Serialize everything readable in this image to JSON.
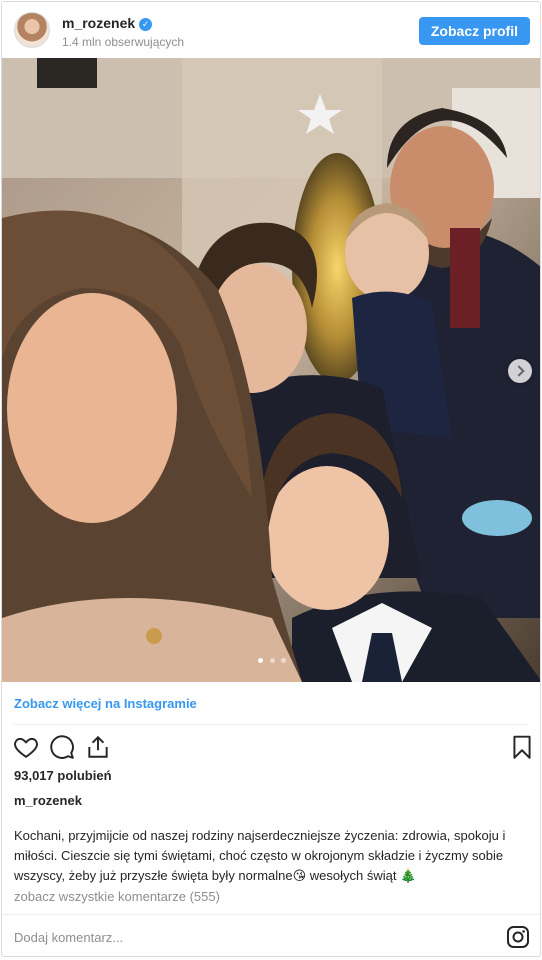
{
  "header": {
    "username": "m_rozenek",
    "verified_mark": "✓",
    "followers": "1.4 mln obserwujących",
    "profile_button": "Zobacz profil"
  },
  "photo": {
    "carousel_dots": 3,
    "active_dot": 1
  },
  "see_more": "Zobacz więcej na Instagramie",
  "actions": {
    "icons": [
      "heart-icon",
      "comment-icon",
      "share-icon",
      "bookmark-icon"
    ]
  },
  "likes": "93,017 polubień",
  "caption": {
    "username": "m_rozenek",
    "text": "Kochani, przyjmijcie od naszej rodziny najserdeczniejsze życzenia: zdrowia, spokoju i miłości. Cieszcie się tymi świętami, choć często w okrojonym składzie i życzmy sobie wszyscy, żeby już przyszłe święta były normalne😘 wesołych świąt 🎄"
  },
  "comments_link": "zobacz wszystkie komentarze (555)",
  "comment_placeholder": "Dodaj komentarz...",
  "colors": {
    "accent": "#3897f0",
    "muted": "#8e8e8e",
    "border": "#dbdbdb"
  }
}
